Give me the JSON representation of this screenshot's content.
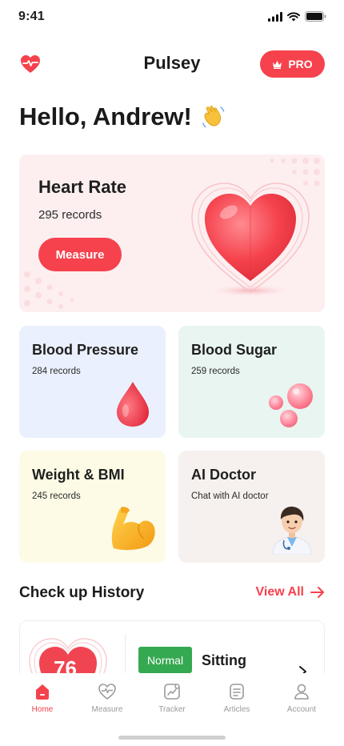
{
  "status_bar": {
    "time": "9:41"
  },
  "header": {
    "app_title": "Pulsey",
    "pro_label": "PRO"
  },
  "greeting": {
    "text": "Hello, Andrew!",
    "emoji": "👋"
  },
  "heart_rate_card": {
    "title": "Heart Rate",
    "records": "295 records",
    "measure_label": "Measure"
  },
  "cards": {
    "blood_pressure": {
      "title": "Blood Pressure",
      "records": "284 records"
    },
    "blood_sugar": {
      "title": "Blood Sugar",
      "records": "259 records"
    },
    "weight_bmi": {
      "title": "Weight & BMI",
      "records": "245 records"
    },
    "ai_doctor": {
      "title": "AI Doctor",
      "subtitle": "Chat with AI doctor"
    }
  },
  "history": {
    "title": "Check up History",
    "view_all": "View All",
    "items": [
      {
        "value": "76",
        "status": "Normal",
        "position": "Sitting"
      }
    ]
  },
  "nav": {
    "items": [
      {
        "label": "Home",
        "icon": "home-icon",
        "active": true
      },
      {
        "label": "Measure",
        "icon": "heart-pulse-icon",
        "active": false
      },
      {
        "label": "Tracker",
        "icon": "chart-icon",
        "active": false
      },
      {
        "label": "Articles",
        "icon": "document-icon",
        "active": false
      },
      {
        "label": "Account",
        "icon": "user-icon",
        "active": false
      }
    ]
  },
  "colors": {
    "accent": "#f5424d",
    "normal": "#35a852"
  }
}
